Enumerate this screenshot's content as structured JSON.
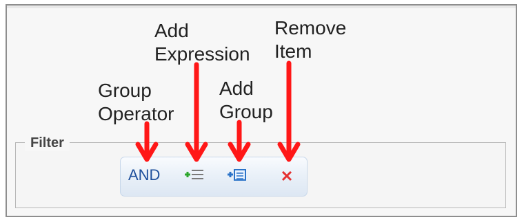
{
  "filter": {
    "legend": "Filter",
    "group_operator": "AND"
  },
  "callouts": {
    "group_operator": "Group\nOperator",
    "add_expression": "Add\nExpression",
    "add_group": "Add\nGroup",
    "remove_item": "Remove\nItem"
  },
  "icons": {
    "add_expression": "add-expression-icon",
    "add_group": "add-group-icon",
    "remove_item": "remove-item-icon"
  },
  "colors": {
    "arrow": "#ff1717",
    "operator_text": "#1e4f9c",
    "toolbar_border": "#c7d7ea"
  }
}
